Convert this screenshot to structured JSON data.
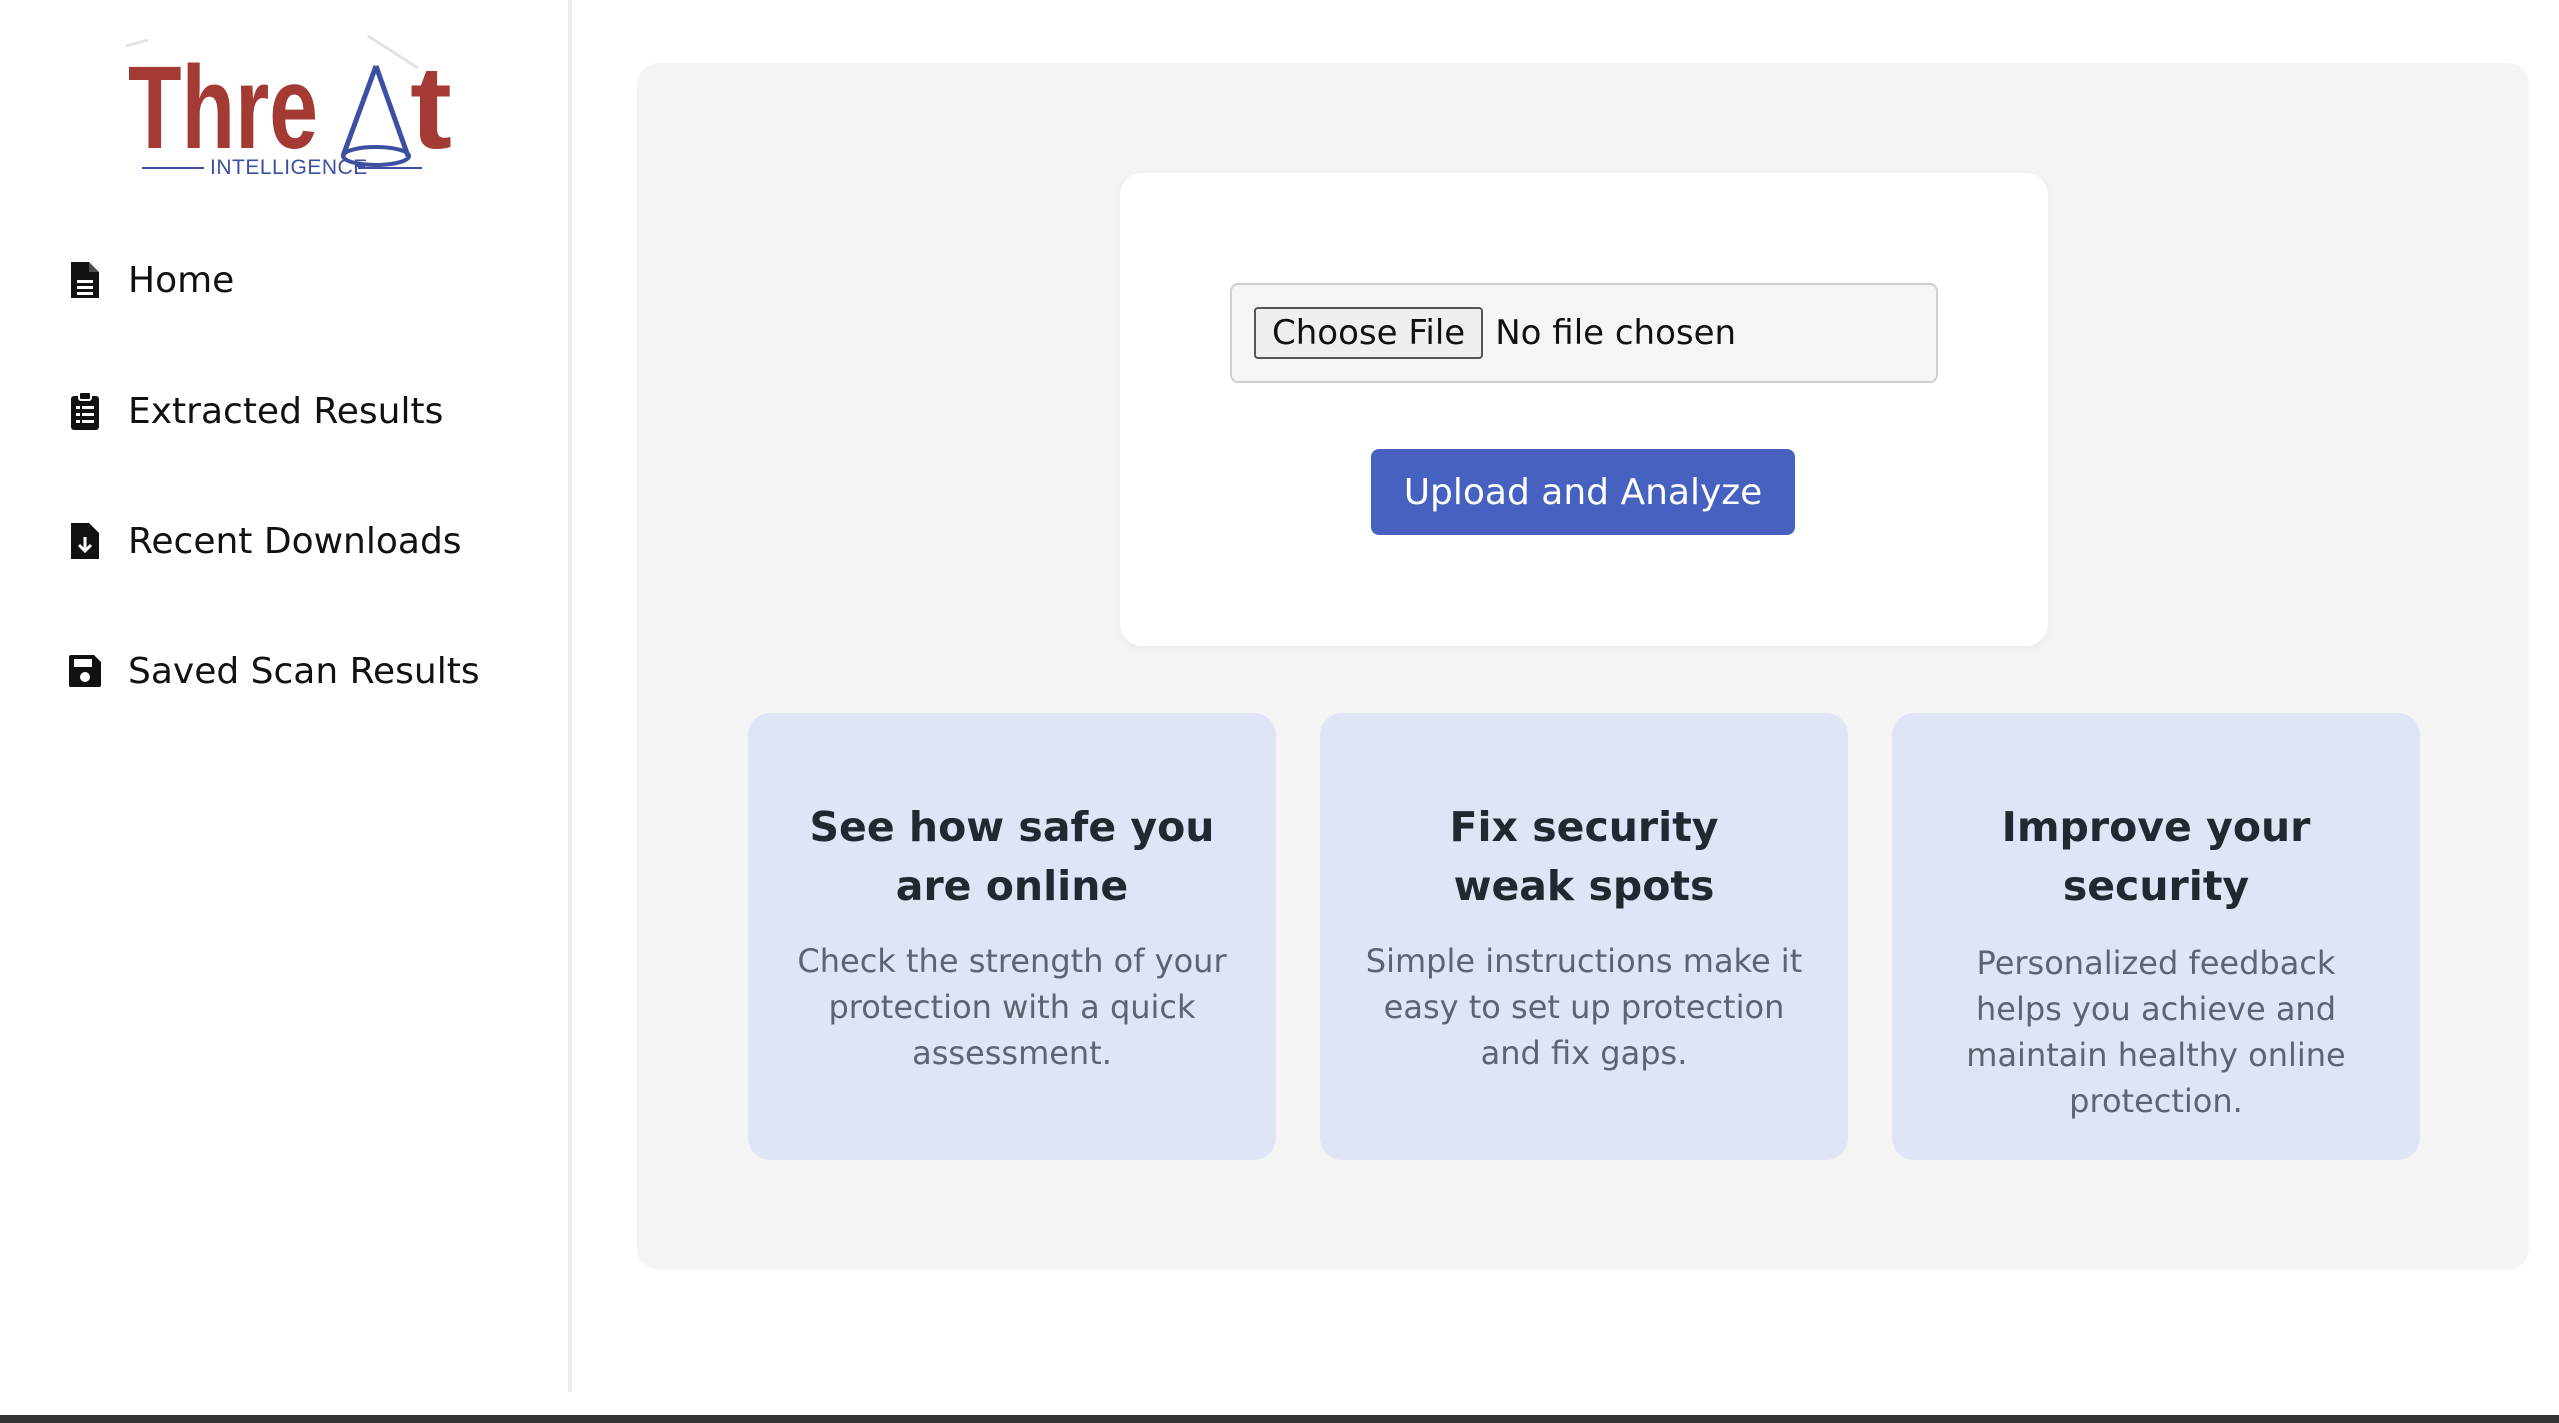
{
  "brand": {
    "logo_text": "Thre t",
    "logo_subtitle": "INTELLIGENCE",
    "logo_color": "#a33a33",
    "subtitle_color": "#3d4fa0"
  },
  "sidebar": {
    "items": [
      {
        "label": "Home",
        "icon": "document-icon"
      },
      {
        "label": "Extracted Results",
        "icon": "clipboard-list-icon"
      },
      {
        "label": "Recent Downloads",
        "icon": "file-download-icon"
      },
      {
        "label": "Saved Scan Results",
        "icon": "floppy-disk-icon"
      }
    ]
  },
  "upload": {
    "choose_label": "Choose File",
    "file_status": "No file chosen",
    "submit_label": "Upload and Analyze",
    "accent": "#4661bf"
  },
  "features": [
    {
      "title": "See how safe you are online",
      "description": "Check the strength of your protection with a quick assessment."
    },
    {
      "title": "Fix security weak spots",
      "description": "Simple instructions make it easy to set up protection and fix gaps."
    },
    {
      "title": "Improve your security",
      "description": "Personalized feedback helps you achieve and maintain healthy online protection."
    }
  ]
}
